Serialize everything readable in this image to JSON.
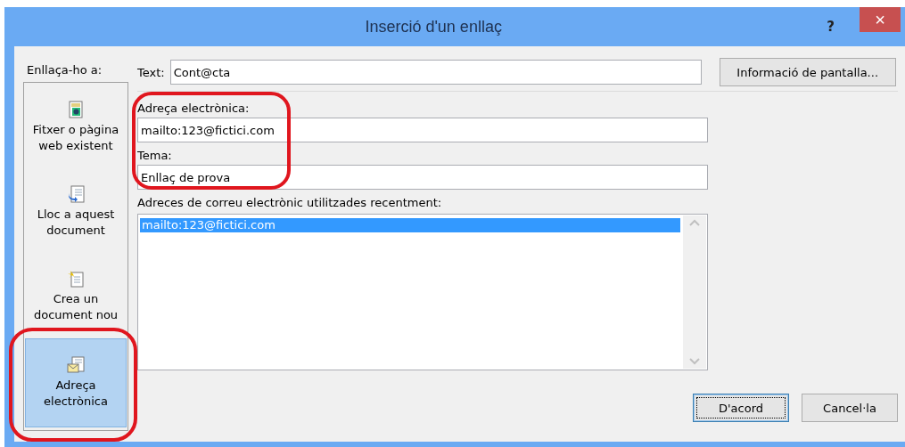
{
  "window": {
    "title": "Inserció d'un enllaç",
    "help": "?",
    "close": "×"
  },
  "link_to": {
    "label": "Enllaça-ho a:",
    "items": [
      {
        "label": "Fitxer o pàgina web existent",
        "kind": "file",
        "selected": false,
        "highlighted": false
      },
      {
        "label": "Lloc a aquest document",
        "kind": "place",
        "selected": false,
        "highlighted": false
      },
      {
        "label": "Crea un document nou",
        "kind": "new",
        "selected": false,
        "highlighted": false
      },
      {
        "label": "Adreça electrònica",
        "kind": "email",
        "selected": true,
        "highlighted": true
      }
    ]
  },
  "text_field": {
    "label": "Text:",
    "value": "Cont@cta"
  },
  "screen_tip_button": "Informació de pantalla...",
  "email_fields": {
    "highlighted": true,
    "address": {
      "label": "Adreça electrònica:",
      "value": "mailto:123@fictici.com"
    },
    "subject": {
      "label": "Tema:",
      "value": "Enllaç de prova"
    }
  },
  "recent": {
    "label": "Adreces de correu electrònic utilitzades recentment:",
    "items": [
      {
        "text": "mailto:123@fictici.com",
        "selected": true
      }
    ]
  },
  "buttons": [
    {
      "label": "D'acord",
      "default": true
    },
    {
      "label": "Cancel·la",
      "default": false
    }
  ]
}
